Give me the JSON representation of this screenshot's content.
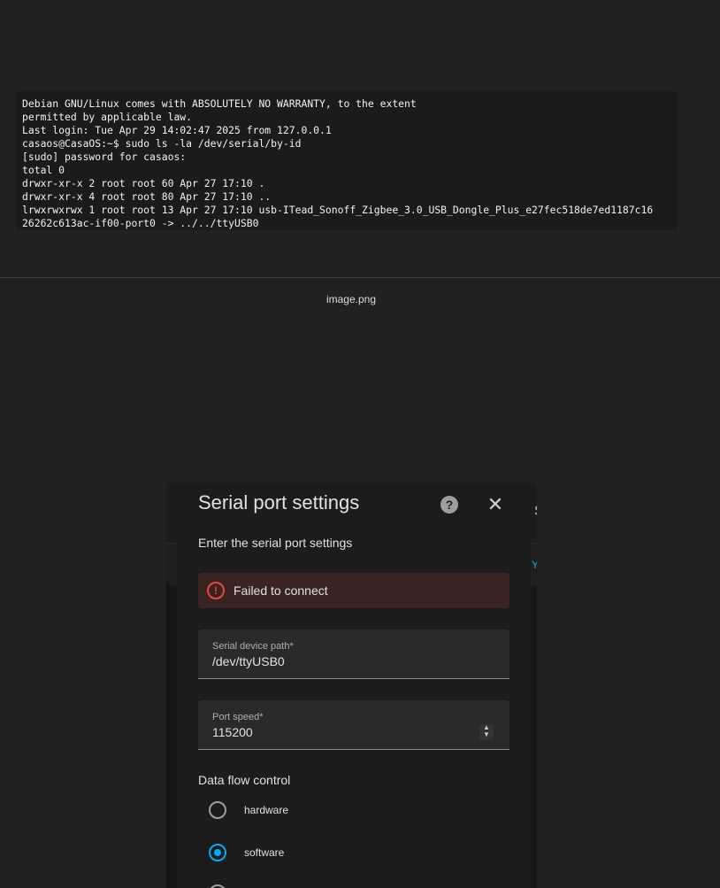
{
  "terminal": {
    "lines": [
      "Debian GNU/Linux comes with ABSOLUTELY NO WARRANTY, to the extent",
      "permitted by applicable law.",
      "Last login: Tue Apr 29 14:02:47 2025 from 127.0.0.1",
      "casaos@CasaOS:~$ sudo ls -la /dev/serial/by-id",
      "[sudo] password for casaos:",
      "total 0",
      "drwxr-xr-x 2 root root 60 Apr 27 17:10 .",
      "drwxr-xr-x 4 root root 80 Apr 27 17:10 ..",
      "lrwxrwxrwx 1 root root 13 Apr 27 17:10 usb-ITead_Sonoff_Zigbee_3.0_USB_Dongle_Plus_e27fec518de7ed1187c16",
      "26262c613ac-if00-port0 -> ../../ttyUSB0"
    ]
  },
  "caption": "image.png",
  "background": {
    "edge_letter_top": "S",
    "edge_letter_mid": "Y"
  },
  "dialog": {
    "title": "Serial port settings",
    "help_icon": "?",
    "close_icon": "✕",
    "subtitle": "Enter the serial port settings",
    "alert": {
      "icon": "!",
      "text": "Failed to connect",
      "color": "#e5483d"
    },
    "fields": {
      "device_path": {
        "label": "Serial device path*",
        "value": "/dev/ttyUSB0"
      },
      "port_speed": {
        "label": "Port speed*",
        "value": "115200"
      }
    },
    "flow_control": {
      "label": "Data flow control",
      "options": [
        {
          "label": "hardware",
          "selected": false
        },
        {
          "label": "software",
          "selected": true
        }
      ]
    },
    "accent_color": "#03a9f4"
  }
}
